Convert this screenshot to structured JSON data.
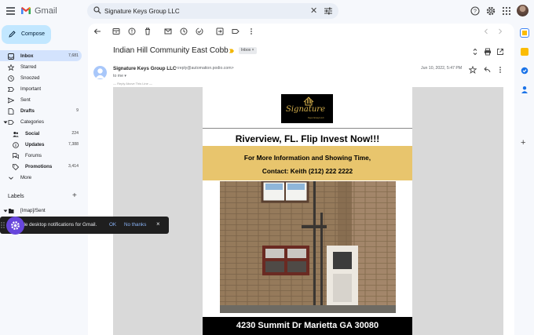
{
  "app": {
    "name": "Gmail"
  },
  "search": {
    "value": "Signature Keys Group LLC"
  },
  "compose": {
    "label": "Compose"
  },
  "nav": {
    "items": [
      {
        "label": "Inbox",
        "count": "7,681"
      },
      {
        "label": "Starred"
      },
      {
        "label": "Snoozed"
      },
      {
        "label": "Important"
      },
      {
        "label": "Sent"
      },
      {
        "label": "Drafts",
        "count": "9"
      },
      {
        "label": "Categories"
      },
      {
        "label": "Social",
        "count": "224"
      },
      {
        "label": "Updates",
        "count": "7,388"
      },
      {
        "label": "Forums"
      },
      {
        "label": "Promotions",
        "count": "3,414"
      },
      {
        "label": "More"
      }
    ],
    "labels_heading": "Labels",
    "label_items": [
      {
        "label": "[Imap]/Sent"
      }
    ]
  },
  "toast": {
    "text": "Enable desktop notifications for Gmail.",
    "visible_text": "ble desktop notifications for Gmail.",
    "ok": "OK",
    "no_thanks": "No thanks",
    "close": "×"
  },
  "message": {
    "subject": "Indian Hill Community East Cobb",
    "inbox_chip": "Inbox ×",
    "sender_name": "Signature Keys Group LLC",
    "sender_email": "<reply@automation.podio.com>",
    "to": "to me ▾",
    "date": "Jun 10, 2022, 5:47 PM",
    "hidden_line": "— Reply Above This Line —"
  },
  "email_body": {
    "brand_script": "Signature",
    "brand_sub": "Keys Group LLC",
    "headline": "Riverview, FL. Flip Invest Now!!!",
    "info_line1": "For More Information and Showing Time,",
    "info_line2": "Contact: Keith (212) 222 2222",
    "address": "4230 Summit Dr Marietta GA 30080"
  },
  "icons": {
    "menu": "hamburger-icon",
    "search": "search-icon",
    "clear": "close-icon",
    "tune": "tune-icon",
    "help": "help-icon",
    "settings": "gear-icon",
    "apps": "apps-grid-icon"
  },
  "colors": {
    "accent": "#0b57d0",
    "compose_bg": "#c2e7ff",
    "nav_active": "#d3e3fd",
    "gold": "#e8c56d",
    "toast_bg": "#1f1f1f",
    "toast_badge": "#6746dc"
  }
}
